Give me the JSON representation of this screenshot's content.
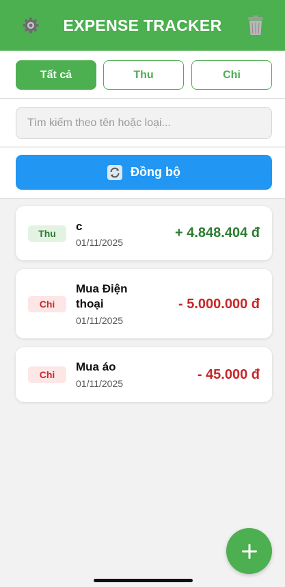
{
  "header": {
    "title": "EXPENSE TRACKER",
    "settings_icon": "gear-icon",
    "delete_icon": "trash-icon"
  },
  "filters": [
    {
      "label": "Tất cả",
      "active": true
    },
    {
      "label": "Thu",
      "active": false
    },
    {
      "label": "Chi",
      "active": false
    }
  ],
  "search": {
    "placeholder": "Tìm kiếm theo tên hoặc loại...",
    "value": ""
  },
  "sync": {
    "label": "Đồng bộ",
    "icon": "sync-icon"
  },
  "transactions": [
    {
      "type_label": "Thu",
      "type": "income",
      "name": "c",
      "date": "01/11/2025",
      "amount": "+ 4.848.404 đ"
    },
    {
      "type_label": "Chi",
      "type": "expense",
      "name": "Mua Điện thoại",
      "date": "01/11/2025",
      "amount": "- 5.000.000 đ"
    },
    {
      "type_label": "Chi",
      "type": "expense",
      "name": "Mua áo",
      "date": "01/11/2025",
      "amount": "- 45.000 đ"
    }
  ],
  "fab": {
    "icon": "plus-icon"
  },
  "colors": {
    "primary_green": "#4caf50",
    "sync_blue": "#2196f3",
    "income_green": "#2e7d32",
    "expense_red": "#c62828"
  }
}
